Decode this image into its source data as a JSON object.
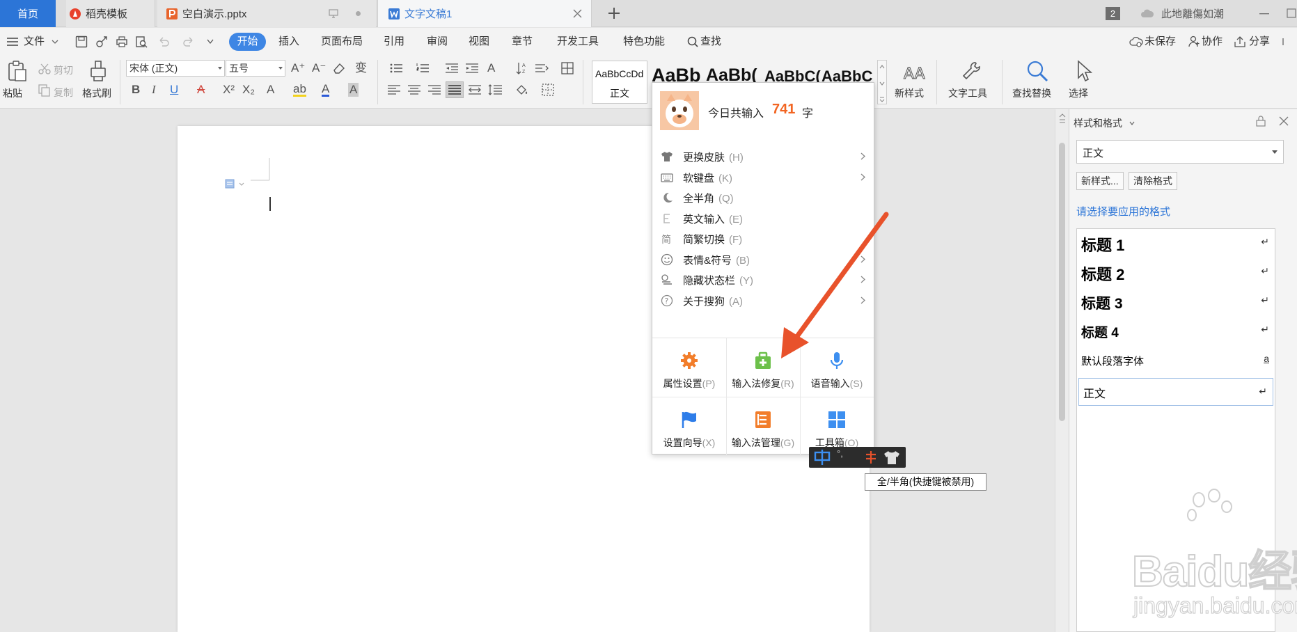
{
  "tabs": {
    "home": "首页",
    "docer": "稻壳模板",
    "ppt": "空白演示.pptx",
    "word": "文字文稿1",
    "window_count": "2",
    "user": "此地離傷如潮"
  },
  "menu": {
    "file": "文件",
    "items": [
      "开始",
      "插入",
      "页面布局",
      "引用",
      "审阅",
      "视图",
      "章节",
      "开发工具",
      "特色功能"
    ],
    "search": "查找",
    "unsaved": "未保存",
    "collab": "协作",
    "share": "分享"
  },
  "ribbon": {
    "paste": "粘贴",
    "cut": "剪切",
    "copy": "复制",
    "format_painter": "格式刷",
    "font_name": "宋体 (正文)",
    "font_size": "五号",
    "style_normal_sample": "AaBbCcDd",
    "style_normal": "正文",
    "heading_samples": [
      "AaBb",
      "AaBb(",
      "AaBbC(",
      "AaBbC"
    ],
    "new_style": "新样式",
    "text_tools": "文字工具",
    "find_replace": "查找替换",
    "select": "选择"
  },
  "ime": {
    "today_label": "今日共输入",
    "today_count": "741",
    "today_unit": "字",
    "menu": [
      {
        "label": "更换皮肤",
        "key": "(H)",
        "icon": "shirt-icon",
        "submenu": true
      },
      {
        "label": "软键盘",
        "key": "(K)",
        "icon": "keyboard-icon",
        "submenu": true
      },
      {
        "label": "全半角",
        "key": "(Q)",
        "icon": "moon-icon",
        "submenu": false
      },
      {
        "label": "英文输入",
        "key": "(E)",
        "icon": "letter-e-icon",
        "submenu": false
      },
      {
        "label": "简繁切换",
        "key": "(F)",
        "icon": "jian-icon",
        "submenu": false
      },
      {
        "label": "表情&符号",
        "key": "(B)",
        "icon": "smiley-icon",
        "submenu": true
      },
      {
        "label": "隐藏状态栏",
        "key": "(Y)",
        "icon": "statusbar-icon",
        "submenu": true
      },
      {
        "label": "关于搜狗",
        "key": "(A)",
        "icon": "help-icon",
        "submenu": true
      }
    ],
    "grid": [
      {
        "label": "属性设置",
        "key": "(P)",
        "icon": "gear-icon",
        "color": "#f27d2a"
      },
      {
        "label": "输入法修复",
        "key": "(R)",
        "icon": "repair-kit-icon",
        "color": "#6cc04a"
      },
      {
        "label": "语音输入",
        "key": "(S)",
        "icon": "microphone-icon",
        "color": "#3d8ff0"
      },
      {
        "label": "设置向导",
        "key": "(X)",
        "icon": "flag-icon",
        "color": "#2e7de9"
      },
      {
        "label": "输入法管理",
        "key": "(G)",
        "icon": "list-icon",
        "color": "#f27d2a"
      },
      {
        "label": "工具箱",
        "key": "(O)",
        "icon": "toolbox-icon",
        "color": "#3d8ff0"
      }
    ],
    "tooltip": "全/半角(快捷键被禁用)"
  },
  "panel": {
    "title": "样式和格式",
    "current_style": "正文",
    "new_style_btn": "新样式...",
    "clear_format_btn": "清除格式",
    "prompt": "请选择要应用的格式",
    "styles": [
      {
        "name": "标题 1",
        "mark": "↵"
      },
      {
        "name": "标题 2",
        "mark": "↵"
      },
      {
        "name": "标题 3",
        "mark": "↵"
      },
      {
        "name": "标题 4",
        "mark": "↵"
      },
      {
        "name": "默认段落字体",
        "mark": "a"
      },
      {
        "name": "正文",
        "mark": "↵"
      }
    ]
  },
  "watermark": {
    "brand": "Baidu经验",
    "url": "jingyan.baidu.com"
  },
  "colors": {
    "accent": "#3e86e4",
    "arrow": "#e8522b",
    "count": "#f26522",
    "prompt": "#2c75d7"
  }
}
